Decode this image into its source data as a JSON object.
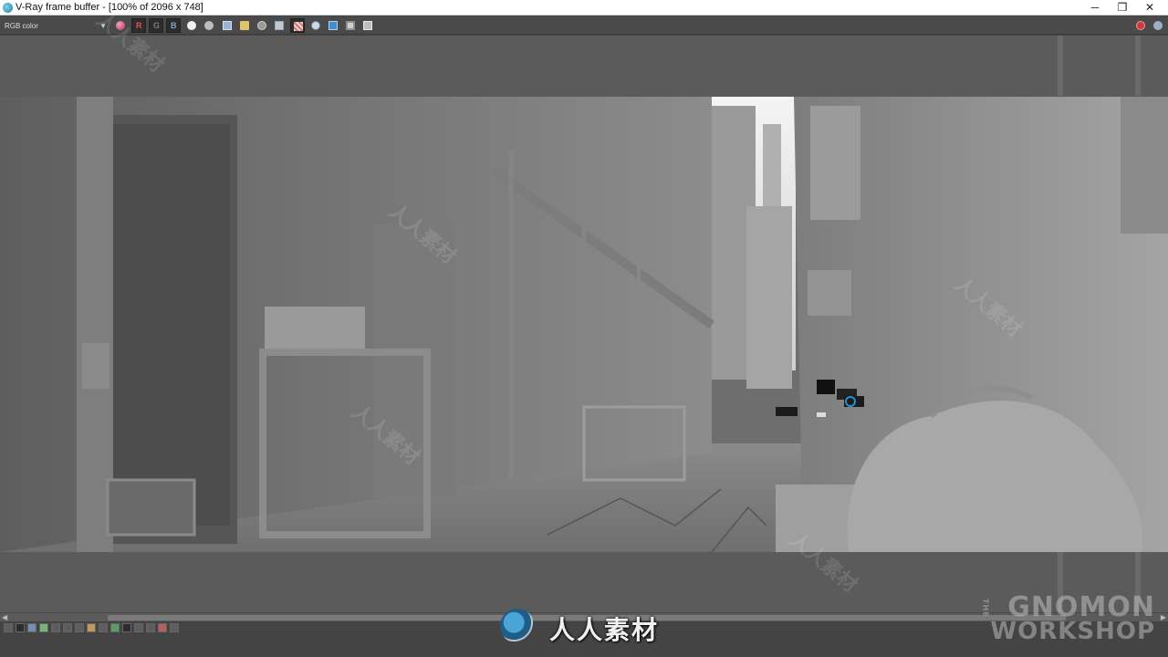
{
  "window": {
    "title": "V-Ray frame buffer - [100% of 2096 x 748]",
    "controls": {
      "minimize": "─",
      "maximize": "❐",
      "close": "✕"
    }
  },
  "toolbar": {
    "channel_select": "RGB color",
    "red_label": "R",
    "green_label": "G",
    "blue_label": "B",
    "icons": [
      "color-picker-icon",
      "red-channel-icon",
      "green-channel-icon",
      "blue-channel-icon",
      "alpha-channel-icon",
      "mono-channel-icon",
      "save-image-icon",
      "open-image-icon",
      "clear-image-icon",
      "duplicate-to-max-icon",
      "track-mouse-icon",
      "zoom-icon",
      "region-render-icon",
      "lens-effects-icon",
      "show-corrections-icon",
      "stop-render-icon",
      "render-icon"
    ]
  },
  "watermark": {
    "brand_text": "人人素材",
    "gnomon_line1": "GNOMON",
    "gnomon_line2": "WORKSHOP",
    "gnomon_the": "THE"
  },
  "colors": {
    "titlebar_bg": "#ffffff",
    "ui_bg": "#444444",
    "viewport_bg": "#5b5b5b",
    "accent_blue": "#2a8ec9",
    "stop_red": "#d03a3a"
  }
}
